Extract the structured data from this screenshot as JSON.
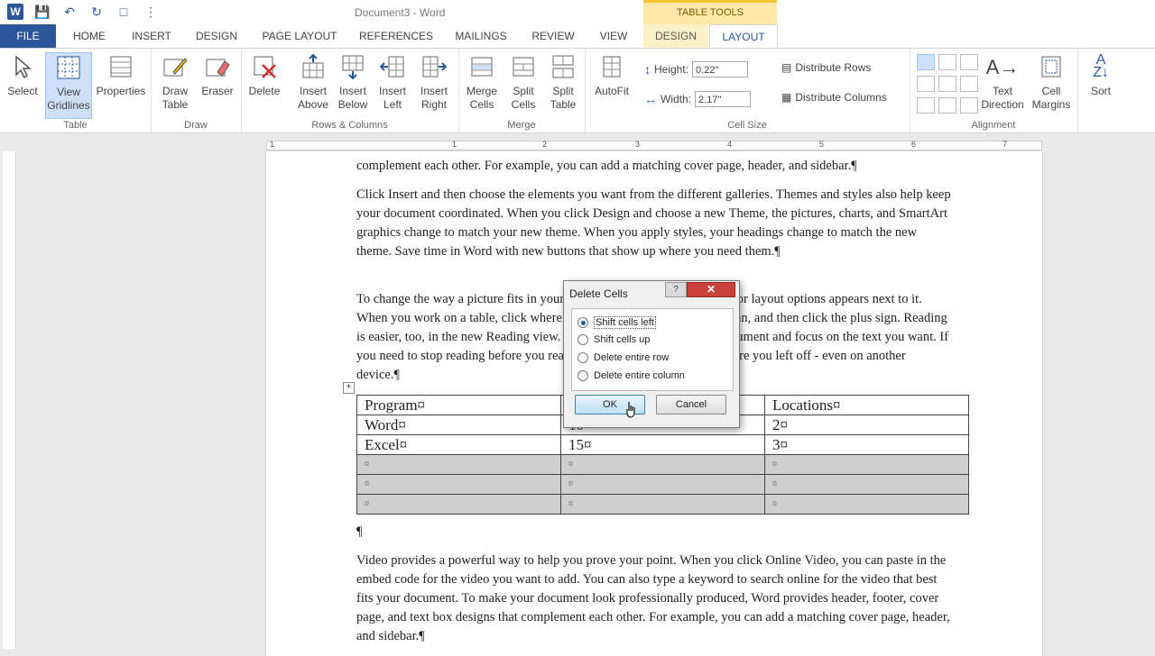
{
  "window": {
    "title": "Document3 - Word",
    "contextual_group": "TABLE TOOLS"
  },
  "tabs": [
    "FILE",
    "HOME",
    "INSERT",
    "DESIGN",
    "PAGE LAYOUT",
    "REFERENCES",
    "MAILINGS",
    "REVIEW",
    "VIEW",
    "DESIGN",
    "LAYOUT"
  ],
  "ribbon": {
    "table": {
      "label": "Table",
      "select": "Select",
      "view_gridlines": "View Gridlines",
      "properties": "Properties"
    },
    "draw": {
      "label": "Draw",
      "draw_table": "Draw Table",
      "eraser": "Eraser"
    },
    "rows_columns": {
      "label": "Rows & Columns",
      "delete": "Delete",
      "insert_above": "Insert Above",
      "insert_below": "Insert Below",
      "insert_left": "Insert Left",
      "insert_right": "Insert Right"
    },
    "merge": {
      "label": "Merge",
      "merge_cells": "Merge Cells",
      "split_cells": "Split Cells",
      "split_table": "Split Table"
    },
    "cell_size": {
      "label": "Cell Size",
      "autofit": "AutoFit",
      "height_label": "Height:",
      "height_value": "0.22\"",
      "width_label": "Width:",
      "width_value": "2.17\"",
      "distribute_rows": "Distribute Rows",
      "distribute_columns": "Distribute Columns"
    },
    "alignment": {
      "label": "Alignment",
      "text_direction": "Text Direction",
      "cell_margins": "Cell Margins",
      "sort": "Sort"
    }
  },
  "ruler": {
    "marks": [
      "1",
      "1",
      "2",
      "3",
      "4",
      "5",
      "6",
      "7"
    ]
  },
  "document": {
    "p1": "complement each other. For example, you can add a matching cover page, header, and sidebar.¶",
    "p2": "Click Insert and then choose the elements you want from the different galleries. Themes and styles also help keep your document coordinated. When you click Design and choose a new Theme, the pictures, charts, and SmartArt graphics change to match your new theme. When you apply styles, your headings change to match the new theme. Save time in Word with new buttons that show up where you need them.¶",
    "p3": "To change the way a picture fits in your document, click it and a button for layout options appears next to it. When you work on a table, click where you want to add a row or a column, and then click the plus sign. Reading is easier, too, in the new Reading view. You can collapse parts of the document and focus on the text you want. If you need to stop reading before you reach the end, Word remembers where you left off - even on another device.¶",
    "table": [
      [
        "Program¤",
        "¤",
        "Locations¤"
      ],
      [
        "Word¤",
        "10¤",
        "2¤"
      ],
      [
        "Excel¤",
        "15¤",
        "3¤"
      ],
      [
        "¤",
        "¤",
        "¤"
      ],
      [
        "¤",
        "¤",
        "¤"
      ],
      [
        "¤",
        "¤",
        "¤"
      ]
    ],
    "after_table": "¶",
    "p4": "Video provides a powerful way to help you prove your point. When you click Online Video, you can paste in the embed code for the video you want to add. You can also type a keyword to search online for the video that best fits your document. To make your document look professionally produced, Word provides header, footer, cover page, and text box designs that complement each other. For example, you can add a matching cover page, header, and sidebar.¶"
  },
  "dialog": {
    "title": "Delete Cells",
    "options": [
      "Shift cells left",
      "Shift cells up",
      "Delete entire row",
      "Delete entire column"
    ],
    "selected_index": 0,
    "ok": "OK",
    "cancel": "Cancel"
  }
}
